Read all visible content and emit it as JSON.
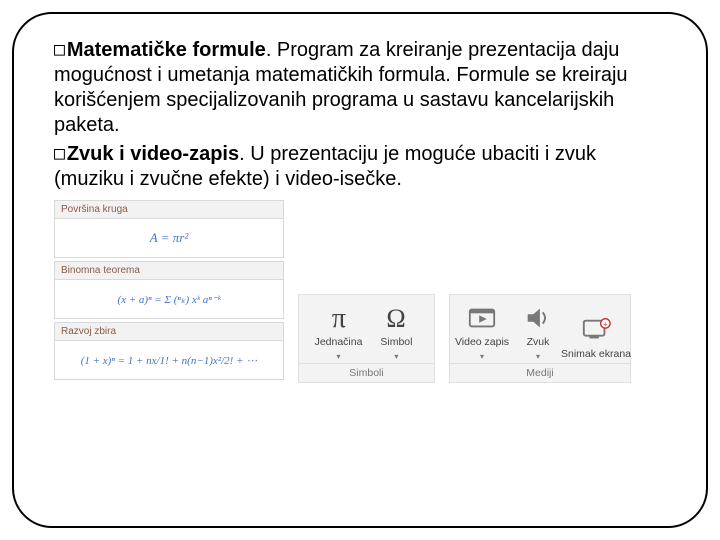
{
  "text": {
    "p1_bold": "Matematičke formule",
    "p1_rest": ". Program za kreiranje prezentacija daju mogućnost i umetanja matematičkih formula. Formule se kreiraju korišćenjem specijalizovanih programa u sastavu kancelarijskih paketa.",
    "p2_bold": "Zvuk i video-zapis",
    "p2_rest": ". U prezentaciju je moguće ubaciti i zvuk (muziku i zvučne efekte) i video-isečke."
  },
  "formulas": {
    "cat1": "Površina kruga",
    "eq1": "A = πr²",
    "cat2": "Binomna teorema",
    "eq2": "(x + a)ⁿ = Σ (ⁿₖ) xᵏ aⁿ⁻ᵏ",
    "cat3": "Razvoj zbira",
    "eq3": "(1 + x)ⁿ = 1 + nx/1! + n(n−1)x²/2! + ⋯"
  },
  "ribbon_simboli": {
    "group": "Simboli",
    "items": [
      {
        "label": "Jednačina",
        "icon": "pi"
      },
      {
        "label": "Simbol",
        "icon": "omega"
      }
    ]
  },
  "ribbon_mediji": {
    "group": "Mediji",
    "items": [
      {
        "label": "Video zapis",
        "icon": "video"
      },
      {
        "label": "Zvuk",
        "icon": "sound"
      },
      {
        "label": "Snimak ekrana",
        "icon": "record"
      }
    ]
  }
}
